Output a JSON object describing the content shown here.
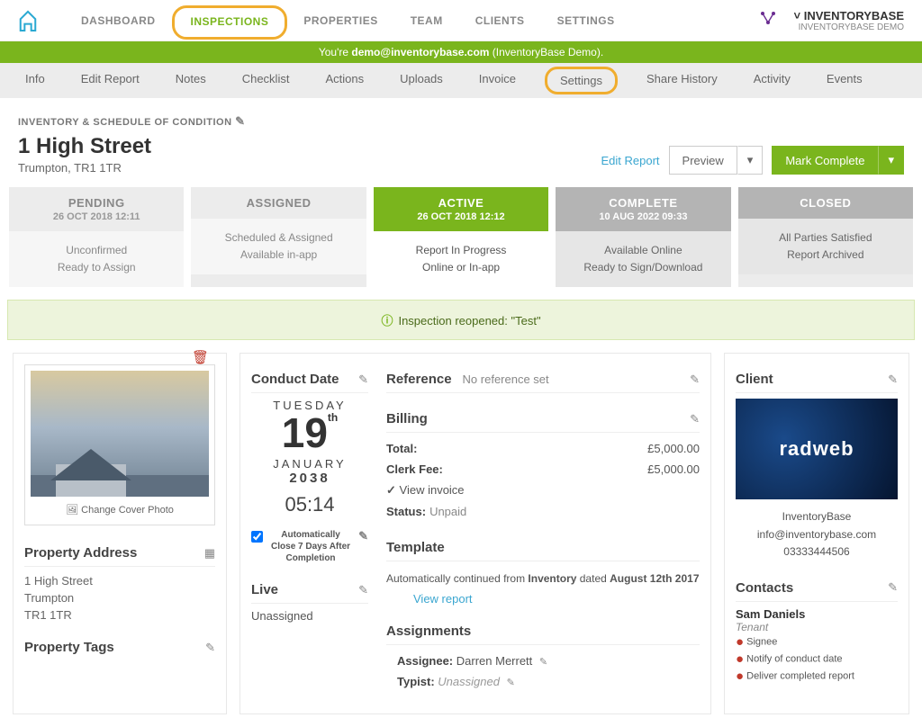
{
  "account": {
    "name": "INVENTORYBASE",
    "sub": "INVENTORYBASE DEMO"
  },
  "topnav": [
    "DASHBOARD",
    "INSPECTIONS",
    "PROPERTIES",
    "TEAM",
    "CLIENTS",
    "SETTINGS"
  ],
  "greenbar": {
    "pre": "You're ",
    "email": "demo@inventorybase.com",
    "post": " (InventoryBase Demo)."
  },
  "subnav": [
    "Info",
    "Edit Report",
    "Notes",
    "Checklist",
    "Actions",
    "Uploads",
    "Invoice",
    "Settings",
    "Share History",
    "Activity",
    "Events"
  ],
  "breadcrumb": "INVENTORY & SCHEDULE OF CONDITION",
  "address": {
    "line1": "1 High Street",
    "line2": "Trumpton, TR1 1TR"
  },
  "header_actions": {
    "edit": "Edit Report",
    "preview": "Preview",
    "complete": "Mark Complete"
  },
  "stages": [
    {
      "title": "PENDING",
      "date": "26 OCT 2018 12:11",
      "l1": "Unconfirmed",
      "l2": "Ready to Assign",
      "state": ""
    },
    {
      "title": "ASSIGNED",
      "date": "",
      "l1": "Scheduled & Assigned",
      "l2": "Available in-app",
      "state": ""
    },
    {
      "title": "ACTIVE",
      "date": "26 OCT 2018 12:12",
      "l1": "Report In Progress",
      "l2": "Online or In-app",
      "state": "active"
    },
    {
      "title": "COMPLETE",
      "date": "10 AUG 2022 09:33",
      "l1": "Available Online",
      "l2": "Ready to Sign/Download",
      "state": "complete"
    },
    {
      "title": "CLOSED",
      "date": "",
      "l1": "All Parties Satisfied",
      "l2": "Report Archived",
      "state": "complete"
    }
  ],
  "alert": "Inspection reopened: \"Test\"",
  "cover": {
    "change": "Change Cover Photo"
  },
  "property_address": {
    "title": "Property Address",
    "l1": "1 High Street",
    "l2": "Trumpton",
    "l3": "TR1 1TR"
  },
  "property_tags": {
    "title": "Property Tags"
  },
  "conduct": {
    "title": "Conduct Date",
    "dow": "TUESDAY",
    "day": "19",
    "suffix": "th",
    "month": "JANUARY",
    "year": "2038",
    "time": "05:14",
    "auto_close": "Automatically Close 7 Days After Completion",
    "live_title": "Live",
    "live_val": "Unassigned"
  },
  "reference": {
    "title": "Reference",
    "val": "No reference set"
  },
  "billing": {
    "title": "Billing",
    "total_lbl": "Total:",
    "total_val": "£5,000.00",
    "clerk_lbl": "Clerk Fee:",
    "clerk_val": "£5,000.00",
    "view": "View invoice",
    "status_lbl": "Status:",
    "status_val": "Unpaid"
  },
  "template": {
    "title": "Template",
    "pre": "Automatically continued from ",
    "name": "Inventory",
    "mid": " dated ",
    "date": "August 12th 2017",
    "view": "View report"
  },
  "assignments": {
    "title": "Assignments",
    "assignee_lbl": "Assignee:",
    "assignee_val": "Darren Merrett",
    "typist_lbl": "Typist:",
    "typist_val": "Unassigned"
  },
  "client": {
    "title": "Client",
    "logo_text": "radweb",
    "name": "InventoryBase",
    "email": "info@inventorybase.com",
    "phone": "03333444506"
  },
  "contacts": {
    "title": "Contacts",
    "name": "Sam Daniels",
    "role": "Tenant",
    "flags": [
      "Signee",
      "Notify of conduct date",
      "Deliver completed report"
    ]
  }
}
